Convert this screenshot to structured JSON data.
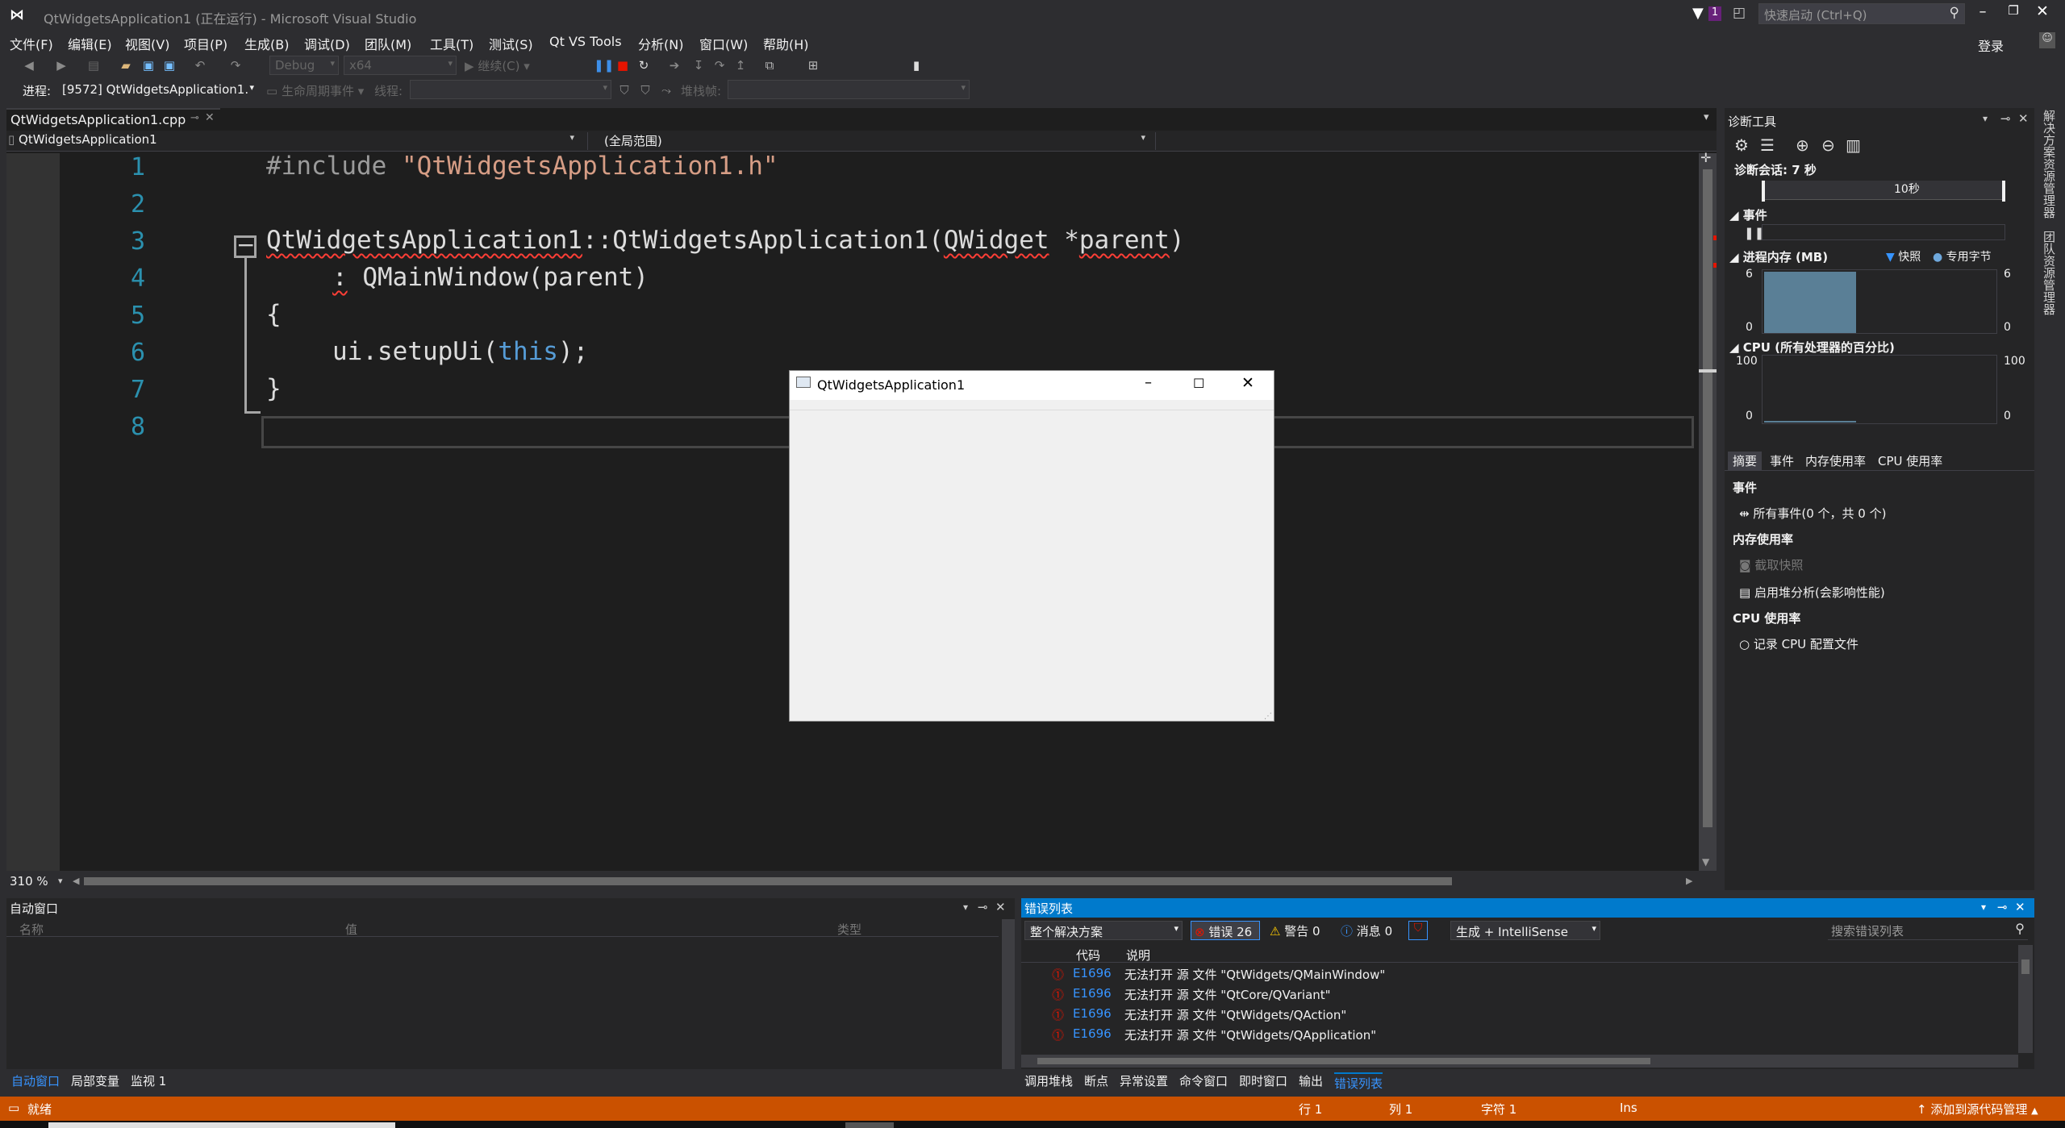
{
  "window": {
    "title": "QtWidgetsApplication1 (正在运行) - Microsoft Visual Studio",
    "notif_count": "1",
    "quick_launch_placeholder": "快速启动 (Ctrl+Q)",
    "login": "登录"
  },
  "menu": [
    "文件(F)",
    "编辑(E)",
    "视图(V)",
    "项目(P)",
    "生成(B)",
    "调试(D)",
    "团队(M)",
    "工具(T)",
    "测试(S)",
    "Qt VS Tools",
    "分析(N)",
    "窗口(W)",
    "帮助(H)"
  ],
  "toolbar1": {
    "config": "Debug",
    "platform": "x64",
    "continue": "继续(C)"
  },
  "toolbar2": {
    "process_label": "进程:",
    "process": "[9572] QtWidgetsApplication1.",
    "lifecycle": "生命周期事件",
    "thread_label": "线程:",
    "stack_label": "堆栈帧:"
  },
  "editor": {
    "tab": "QtWidgetsApplication1.cpp",
    "scope_left": "QtWidgetsApplication1",
    "scope_right": "(全局范围)",
    "zoom": "310 %",
    "line_numbers": [
      "1",
      "2",
      "3",
      "4",
      "5",
      "6",
      "7",
      "8"
    ],
    "lines": {
      "l1_pp": "#include ",
      "l1_str": "\"QtWidgetsApplication1.h\"",
      "l3_cls": "QtWidgetsApplication1",
      "l3_sep": "::",
      "l3_fn": "QtWidgetsApplication1",
      "l3_open": "(",
      "l3_type": "QWidget",
      "l3_star": " *",
      "l3_param": "parent",
      "l3_close": ")",
      "l4_colon": ":",
      "l4_rest": " QMainWindow(parent)",
      "l5": "{",
      "l6_a": "ui.setupUi(",
      "l6_kw": "this",
      "l6_b": ");",
      "l7": "}"
    }
  },
  "diagnostics": {
    "title": "诊断工具",
    "session": "诊断会话: 7 秒",
    "timeline_tick": "10秒",
    "events_header": "事件",
    "memory_header": "进程内存 (MB)",
    "legend_snapshot": "快照",
    "legend_private": "专用字节",
    "mem_max": "6",
    "mem_min": "0",
    "cpu_header": "CPU (所有处理器的百分比)",
    "cpu_max": "100",
    "cpu_min": "0",
    "tabs": [
      "摘要",
      "事件",
      "内存使用率",
      "CPU 使用率"
    ],
    "summary": {
      "events_title": "事件",
      "all_events": "所有事件(0 个，共 0 个)",
      "memory_title": "内存使用率",
      "take_snapshot": "截取快照",
      "heap_profile": "启用堆分析(会影响性能)",
      "cpu_title": "CPU 使用率",
      "record_cpu": "记录 CPU 配置文件"
    }
  },
  "right_rail": [
    "解决方案资源管理器",
    "团队资源管理器"
  ],
  "autos": {
    "title": "自动窗口",
    "col_name": "名称",
    "col_value": "值",
    "col_type": "类型",
    "tabs": [
      "自动窗口",
      "局部变量",
      "监视 1"
    ]
  },
  "errors": {
    "title": "错误列表",
    "scope": "整个解决方案",
    "errors_btn": "错误 26",
    "warnings_btn": "警告 0",
    "messages_btn": "消息 0",
    "build_filter": "生成 + IntelliSense",
    "search_placeholder": "搜索错误列表",
    "col_code": "代码",
    "col_desc": "说明",
    "rows": [
      {
        "code": "E1696",
        "desc": "无法打开 源 文件 \"QtWidgets/QMainWindow\""
      },
      {
        "code": "E1696",
        "desc": "无法打开 源 文件 \"QtCore/QVariant\""
      },
      {
        "code": "E1696",
        "desc": "无法打开 源 文件 \"QtWidgets/QAction\""
      },
      {
        "code": "E1696",
        "desc": "无法打开 源 文件 \"QtWidgets/QApplication\""
      }
    ],
    "tabs": [
      "调用堆栈",
      "断点",
      "异常设置",
      "命令窗口",
      "即时窗口",
      "输出",
      "错误列表"
    ]
  },
  "status": {
    "ready": "就绪",
    "line": "行 1",
    "col": "列 1",
    "char": "字符 1",
    "ins": "Ins",
    "source_control": "添加到源代码管理"
  },
  "qt_window": {
    "title": "QtWidgetsApplication1"
  },
  "colors": {
    "accent": "#007acc",
    "status": "#ca5100",
    "editor_bg": "#1e1e1e"
  }
}
